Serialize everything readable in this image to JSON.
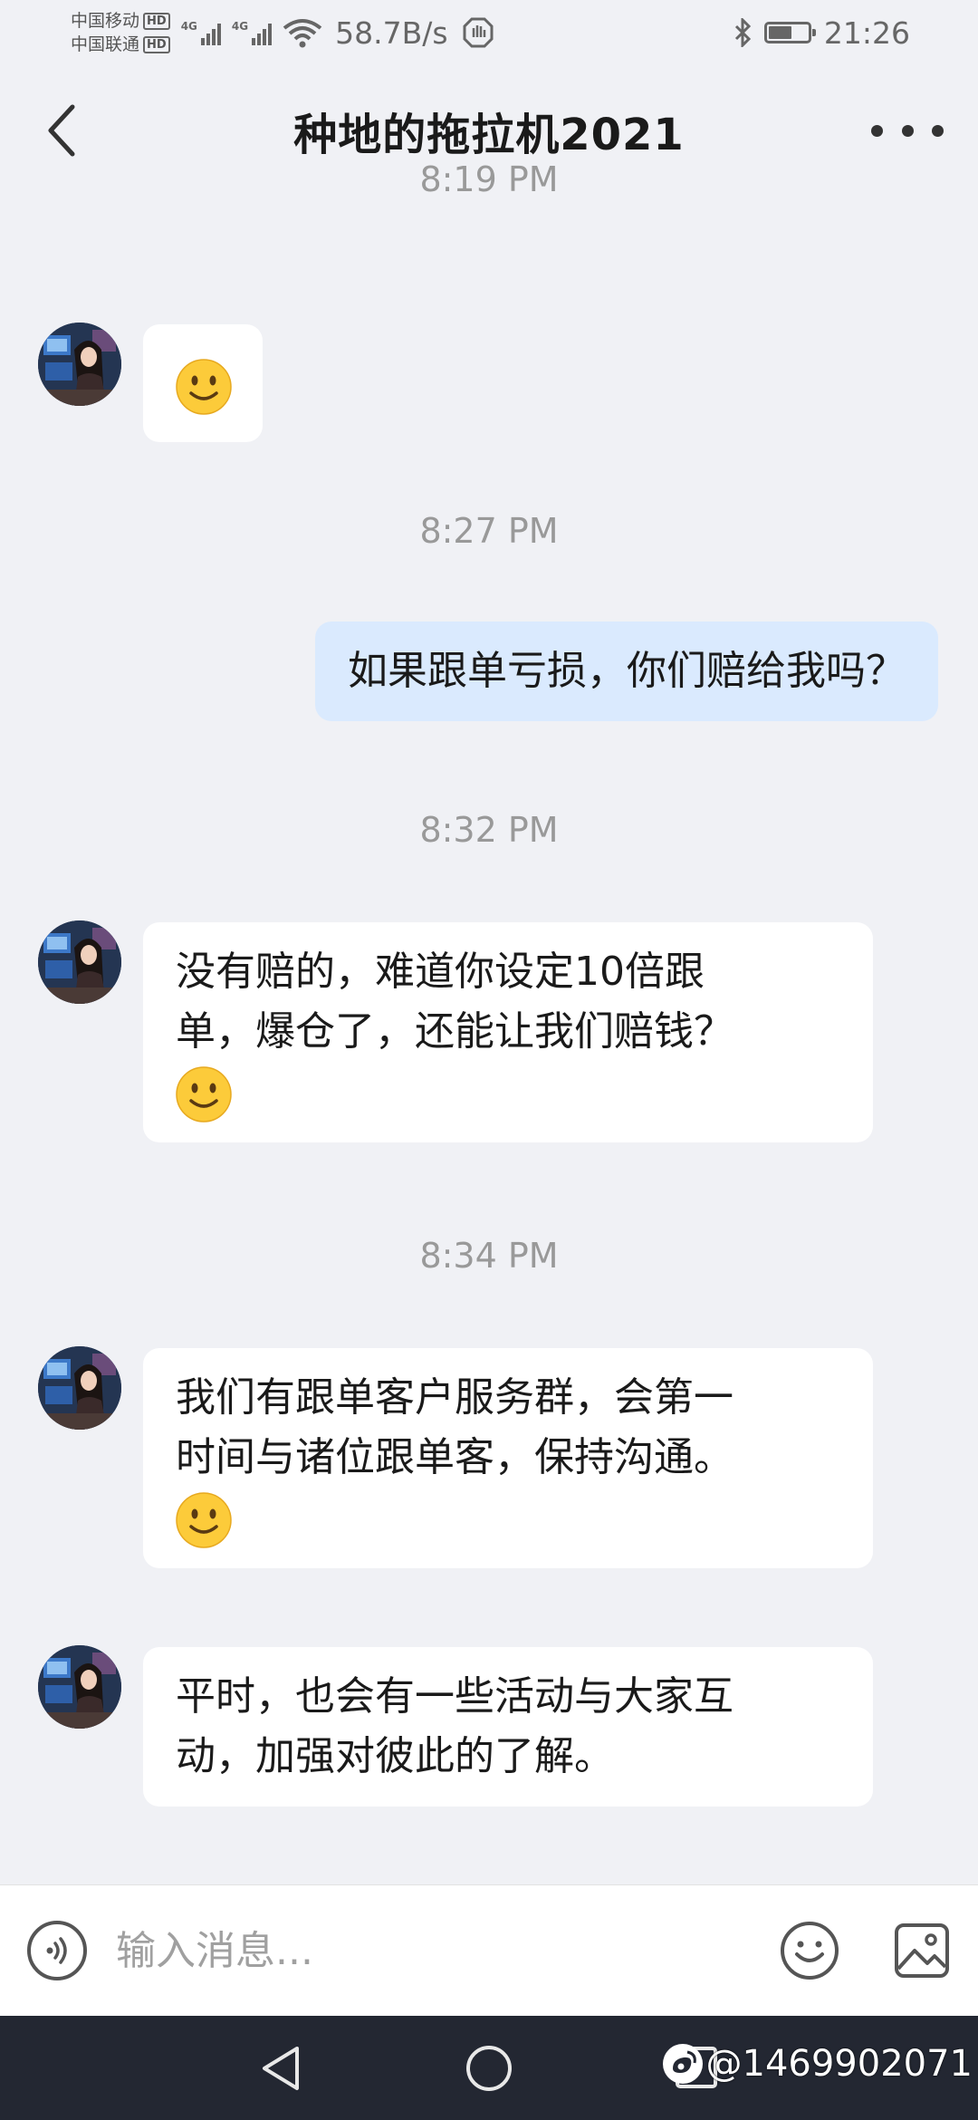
{
  "status_bar": {
    "carrier_1": "中国移动",
    "carrier_2": "中国联通",
    "hd_badge": "HD",
    "signal_label": "4G",
    "net_speed": "58.7B/s",
    "time": "21:26",
    "battery_level": 0.6
  },
  "header": {
    "title": "种地的拖拉机2021"
  },
  "messages": [
    {
      "timestamp": "8:19 PM",
      "sender": "other",
      "text": "",
      "emoji": "smile"
    },
    {
      "timestamp": "8:27 PM",
      "sender": "me",
      "text": "如果跟单亏损，你们赔给我吗？"
    },
    {
      "timestamp": "8:32 PM",
      "sender": "other",
      "line1": "没有赔的，难道你设定10倍跟",
      "line2": "单，爆仓了，还能让我们赔钱？",
      "emoji": "smile"
    },
    {
      "timestamp": "8:34 PM",
      "sender": "other",
      "line1": "我们有跟单客户服务群，会第一",
      "line2": "时间与诸位跟单客，保持沟通。",
      "emoji": "smile"
    },
    {
      "sender": "other",
      "line1": "平时，也会有一些活动与大家互",
      "line2": "动，加强对彼此的了解。"
    }
  ],
  "input_bar": {
    "placeholder": "输入消息..."
  },
  "watermark": {
    "text": "@1469902071"
  },
  "colors": {
    "background": "#f0f1f5",
    "my_bubble": "#daeafe",
    "other_bubble": "#ffffff",
    "timestamp": "#999999",
    "nav_bar": "#232732"
  }
}
